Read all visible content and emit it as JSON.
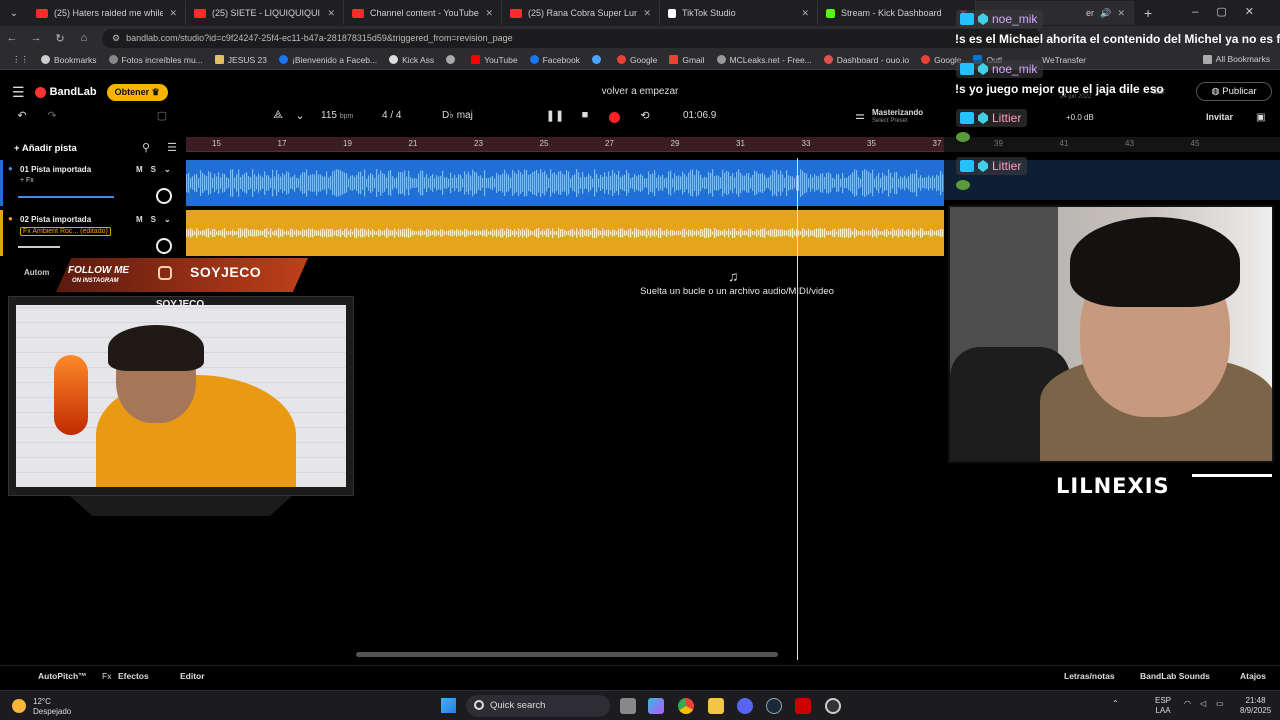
{
  "browser": {
    "tabs": [
      {
        "title": "(25) Haters raided me while I w",
        "color": "#ff2b2b"
      },
      {
        "title": "(25) SIETE - LIQUIQUIQUI (Visu",
        "color": "#ff2b2b"
      },
      {
        "title": "Channel content - YouTube St",
        "color": "#ff2b2b"
      },
      {
        "title": "(25) Rana Cobra Super Lumino",
        "color": "#ff2b2b"
      },
      {
        "title": "TikTok Studio",
        "color": "#ffffff"
      },
      {
        "title": "Stream - Kick Dashboard",
        "color": "#53fc18"
      },
      {
        "title": "empezar - Stu",
        "color": "#ff4b4b"
      }
    ],
    "url": "bandlab.com/studio?id=c9f24247-25f4-ec11-b47a-281878315d59&triggered_from=revision_page",
    "bookmarks": [
      {
        "label": "Bookmarks",
        "color": "#cccccc"
      },
      {
        "label": "Fotos increíbles mu...",
        "color": "#888888"
      },
      {
        "label": "JESUS 23",
        "color": "#e0c060"
      },
      {
        "label": "¡Bienvenido a Faceb...",
        "color": "#1877f2"
      },
      {
        "label": "Kick Ass",
        "color": "#dddddd"
      },
      {
        "label": "",
        "color": "#aaaaaa"
      },
      {
        "label": "YouTube",
        "color": "#ff0000"
      },
      {
        "label": "Facebook",
        "color": "#1877f2"
      },
      {
        "label": "",
        "color": "#4aa3ff"
      },
      {
        "label": "Google",
        "color": "#ea4335"
      },
      {
        "label": "Gmail",
        "color": "#ea4335"
      },
      {
        "label": "MCLeaks.net - Free...",
        "color": "#999999"
      },
      {
        "label": "Dashboard - ouo.io",
        "color": "#e05050"
      },
      {
        "label": "Google",
        "color": "#ea4335"
      },
      {
        "label": "Outl",
        "color": "#0078d4"
      },
      {
        "label": "WeTransfer",
        "color": "#409fff"
      }
    ],
    "all_bookmarks": "All Bookmarks"
  },
  "bandlab": {
    "logo": "BandLab",
    "obtener": "Obtener",
    "song_title": "volver a empezar",
    "bpm": "115",
    "bpm_unit": "bpm",
    "time_sig": "4 / 4",
    "key": "D♭ maj",
    "time": "01:06.9",
    "mastering": "Masterizando",
    "mastering_sub": "Select Preset",
    "add_track": "Añadir pista",
    "ruler": [
      "15",
      "17",
      "19",
      "21",
      "23",
      "25",
      "27",
      "29",
      "31",
      "33",
      "35",
      "37"
    ],
    "ruler_right": [
      "39",
      "41",
      "43",
      "45"
    ],
    "tracks": [
      {
        "name": "01  Pista importada",
        "fx": "+ Fx",
        "color": "#1f6fd6",
        "volume": 0.8
      },
      {
        "name": "02  Pista importada",
        "fx": "Fx Ambient Roc... (editado)",
        "color": "#e6a31c",
        "volume": 0.35
      }
    ],
    "automation": "Autom",
    "drop_hint": "Suelta un bucle o un archivo audio/MIDI/video",
    "publicar": "Publicar",
    "invitar": "Invitar",
    "gain": "+0.0 dB",
    "partial": "dar",
    "date": "24 jun 2022",
    "bottom": {
      "autopitch": "AutoPitch™",
      "efectos": "Efectos",
      "editor": "Editor",
      "letras": "Letras/notas",
      "sounds": "BandLab Sounds",
      "atajos": "Atajos"
    }
  },
  "chat": [
    {
      "user": "noe_mik",
      "message": "!s es el Michael ahorita el contenido del Michel ya no es f"
    },
    {
      "user": "noe_mik",
      "message": "!s yo juego mejor que el jaja dile eso"
    },
    {
      "user": "Littier",
      "message": ""
    },
    {
      "user": "Littier",
      "message": ""
    }
  ],
  "overlay": {
    "follow_line1": "FOLLOW ME",
    "follow_line2": "ON INSTAGRAM",
    "handle": "SOYJECO",
    "cam_title": "SOYJECO",
    "right_cam_name": "LILNEXIS"
  },
  "taskbar": {
    "weather_temp": "12°C",
    "weather_desc": "Despejado",
    "search": "Quick search",
    "lang": "ESP",
    "lang_sub": "LAA",
    "time": "21:48",
    "date": "8/9/2025"
  }
}
